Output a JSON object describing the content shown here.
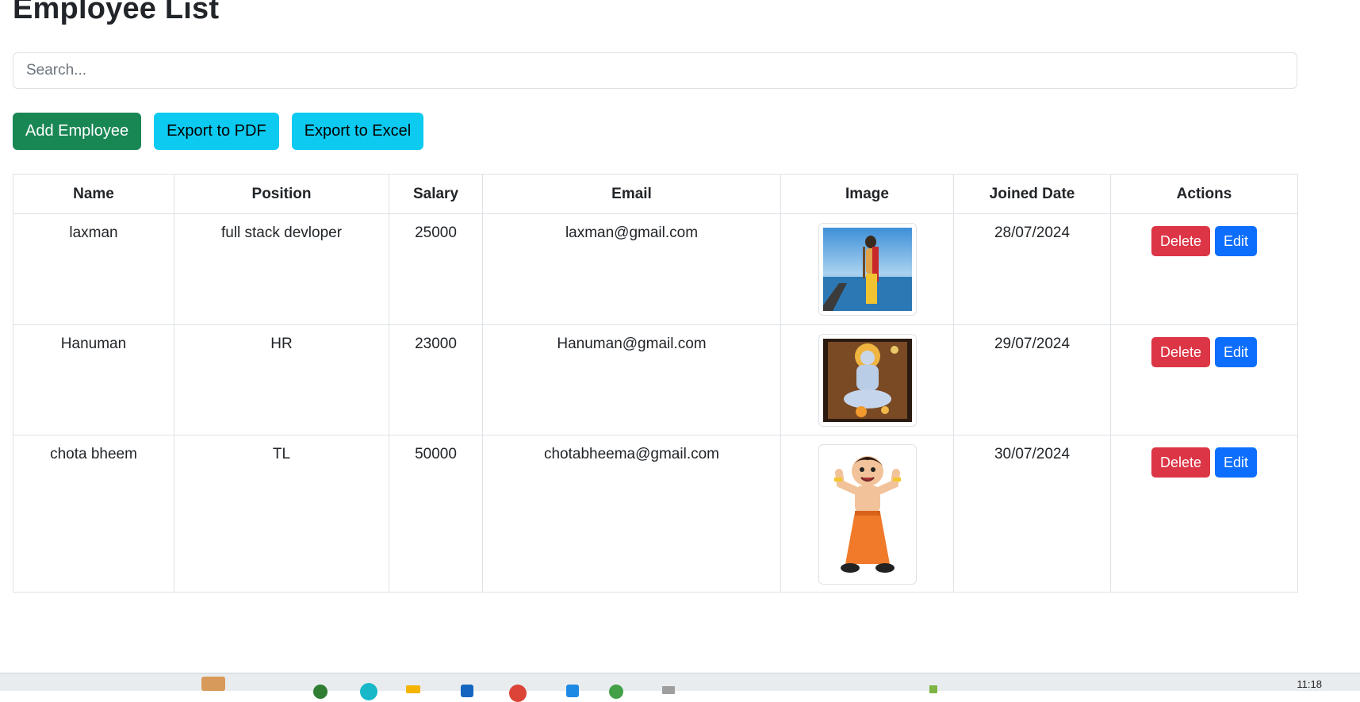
{
  "page": {
    "title": "Employee List"
  },
  "search": {
    "placeholder": "Search..."
  },
  "toolbar": {
    "add_label": "Add Employee",
    "pdf_label": "Export to PDF",
    "excel_label": "Export to Excel"
  },
  "table": {
    "headers": [
      "Name",
      "Position",
      "Salary",
      "Email",
      "Image",
      "Joined Date",
      "Actions"
    ],
    "rows": [
      {
        "name": "laxman",
        "position": "full stack devloper",
        "salary": "25000",
        "email": "laxman@gmail.com",
        "image": "sea-bridge-figure-photo",
        "joined": "28/07/2024",
        "delete_label": "Delete",
        "edit_label": "Edit"
      },
      {
        "name": "Hanuman",
        "position": "HR",
        "salary": "23000",
        "email": "Hanuman@gmail.com",
        "image": "seated-deity-photo",
        "joined": "29/07/2024",
        "delete_label": "Delete",
        "edit_label": "Edit"
      },
      {
        "name": "chota bheem",
        "position": "TL",
        "salary": "50000",
        "email": "chotabheema@gmail.com",
        "image": "cartoon-boy-flexing",
        "joined": "30/07/2024",
        "delete_label": "Delete",
        "edit_label": "Edit"
      }
    ]
  },
  "taskbar": {
    "clock": "11:18"
  },
  "colors": {
    "success": "#198754",
    "info": "#0dcaf0",
    "danger": "#dc3545",
    "primary": "#0d6efd",
    "border": "#dee2e6"
  }
}
